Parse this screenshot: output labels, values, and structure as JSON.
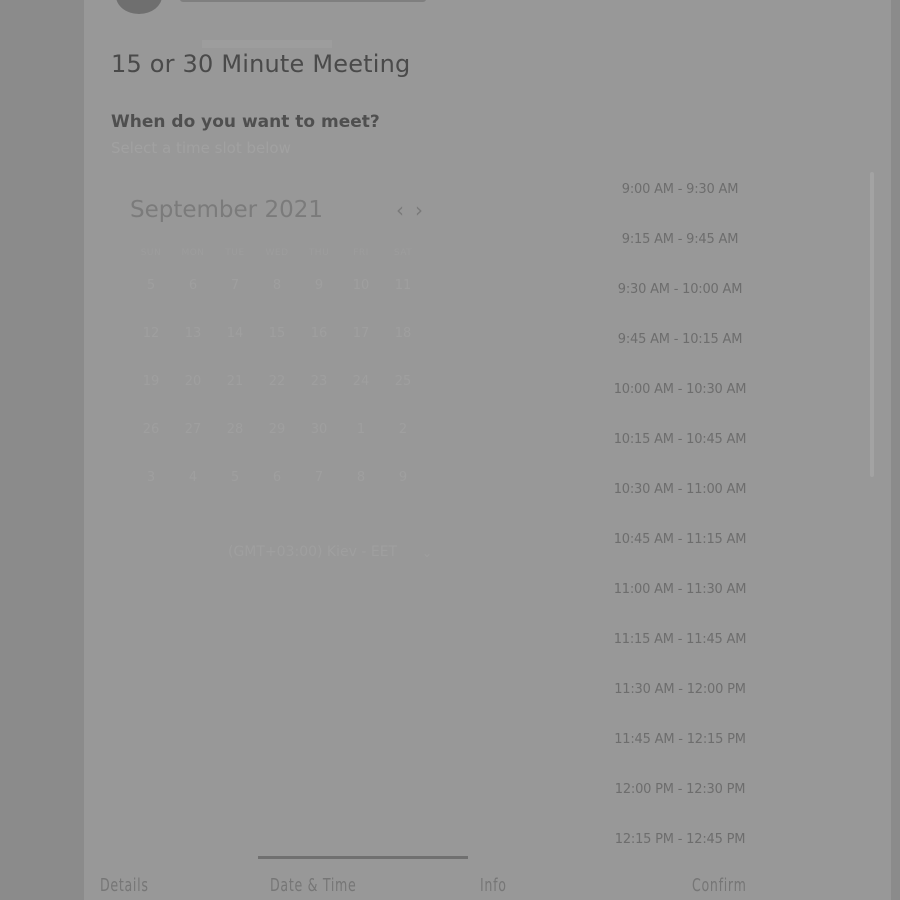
{
  "event": {
    "title": "15 or 30 Minute Meeting",
    "question": "When do you want to meet?",
    "subnote": "Select a time slot below"
  },
  "calendar": {
    "month_label": "September 2021",
    "prev_icon": "chevron-left-icon",
    "next_icon": "chevron-right-icon",
    "weekdays": [
      "SUN",
      "MON",
      "TUE",
      "WED",
      "THU",
      "FRI",
      "SAT"
    ],
    "weeks": [
      [
        "5",
        "6",
        "7",
        "8",
        "9",
        "10",
        "11"
      ],
      [
        "12",
        "13",
        "14",
        "15",
        "16",
        "17",
        "18"
      ],
      [
        "19",
        "20",
        "21",
        "22",
        "23",
        "24",
        "25"
      ],
      [
        "26",
        "27",
        "28",
        "29",
        "30",
        "1",
        "2"
      ],
      [
        "3",
        "4",
        "5",
        "6",
        "7",
        "8",
        "9"
      ]
    ]
  },
  "timezone": {
    "label": "(GMT+03:00) Kiev - EET",
    "caret_icon": "chevron-down-icon"
  },
  "slots": [
    "9:00 AM - 9:30 AM",
    "9:15 AM - 9:45 AM",
    "9:30 AM - 10:00 AM",
    "9:45 AM - 10:15 AM",
    "10:00 AM - 10:30 AM",
    "10:15 AM - 10:45 AM",
    "10:30 AM - 11:00 AM",
    "10:45 AM - 11:15 AM",
    "11:00 AM - 11:30 AM",
    "11:15 AM - 11:45 AM",
    "11:30 AM - 12:00 PM",
    "11:45 AM - 12:15 PM",
    "12:00 PM - 12:30 PM",
    "12:15 PM - 12:45 PM"
  ],
  "bottom_tabs": [
    "Details",
    "Date & Time",
    "Info",
    "Confirm"
  ]
}
